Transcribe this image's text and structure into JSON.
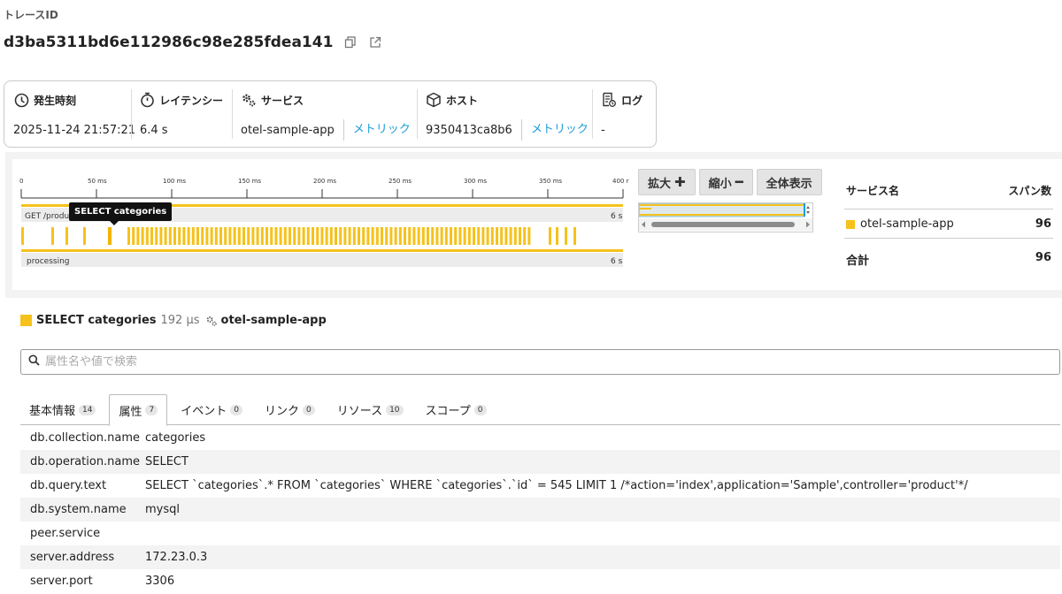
{
  "header": {
    "label": "トレースID",
    "trace_id": "d3ba5311bd6e112986c98e285fdea141"
  },
  "summary": {
    "time": {
      "label": "発生時刻",
      "value": "2025-11-24 21:57:21"
    },
    "latency": {
      "label": "レイテンシー",
      "value": "6.4 s"
    },
    "service": {
      "label": "サービス",
      "value": "otel-sample-app",
      "link": "メトリック"
    },
    "host": {
      "label": "ホスト",
      "value": "9350413ca8b6",
      "link": "メトリック"
    },
    "log": {
      "label": "ログ",
      "value": "-"
    }
  },
  "timeline": {
    "ticks": [
      "0",
      "50 ms",
      "100 ms",
      "150 ms",
      "200 ms",
      "250 ms",
      "300 ms",
      "350 ms",
      "400 r"
    ],
    "tooltip": "SELECT categories",
    "spans": [
      {
        "name": "GET /product",
        "duration": "6 s"
      },
      {
        "name": "processing",
        "duration": "6 s"
      }
    ],
    "color": "#f5c21b"
  },
  "zoom": {
    "in": "拡大",
    "out": "縮小",
    "fit": "全体表示"
  },
  "services": {
    "col_name": "サービス名",
    "col_count": "スパン数",
    "rows": [
      {
        "name": "otel-sample-app",
        "count": "96"
      }
    ],
    "total_label": "合計",
    "total": "96"
  },
  "span": {
    "name": "SELECT categories",
    "duration": "192 μs",
    "service": "otel-sample-app"
  },
  "search": {
    "placeholder": "属性名や値で検索"
  },
  "tabs": [
    {
      "label": "基本情報",
      "count": "14"
    },
    {
      "label": "属性",
      "count": "7"
    },
    {
      "label": "イベント",
      "count": "0"
    },
    {
      "label": "リンク",
      "count": "0"
    },
    {
      "label": "リソース",
      "count": "10"
    },
    {
      "label": "スコープ",
      "count": "0"
    }
  ],
  "attributes": [
    {
      "key": "db.collection.name",
      "value": "categories"
    },
    {
      "key": "db.operation.name",
      "value": "SELECT"
    },
    {
      "key": "db.query.text",
      "value": "SELECT `categories`.* FROM `categories` WHERE `categories`.`id` = 545 LIMIT 1 /*action='index',application='Sample',controller='product'*/"
    },
    {
      "key": "db.system.name",
      "value": "mysql"
    },
    {
      "key": "peer.service",
      "value": ""
    },
    {
      "key": "server.address",
      "value": "172.23.0.3"
    },
    {
      "key": "server.port",
      "value": "3306"
    }
  ]
}
